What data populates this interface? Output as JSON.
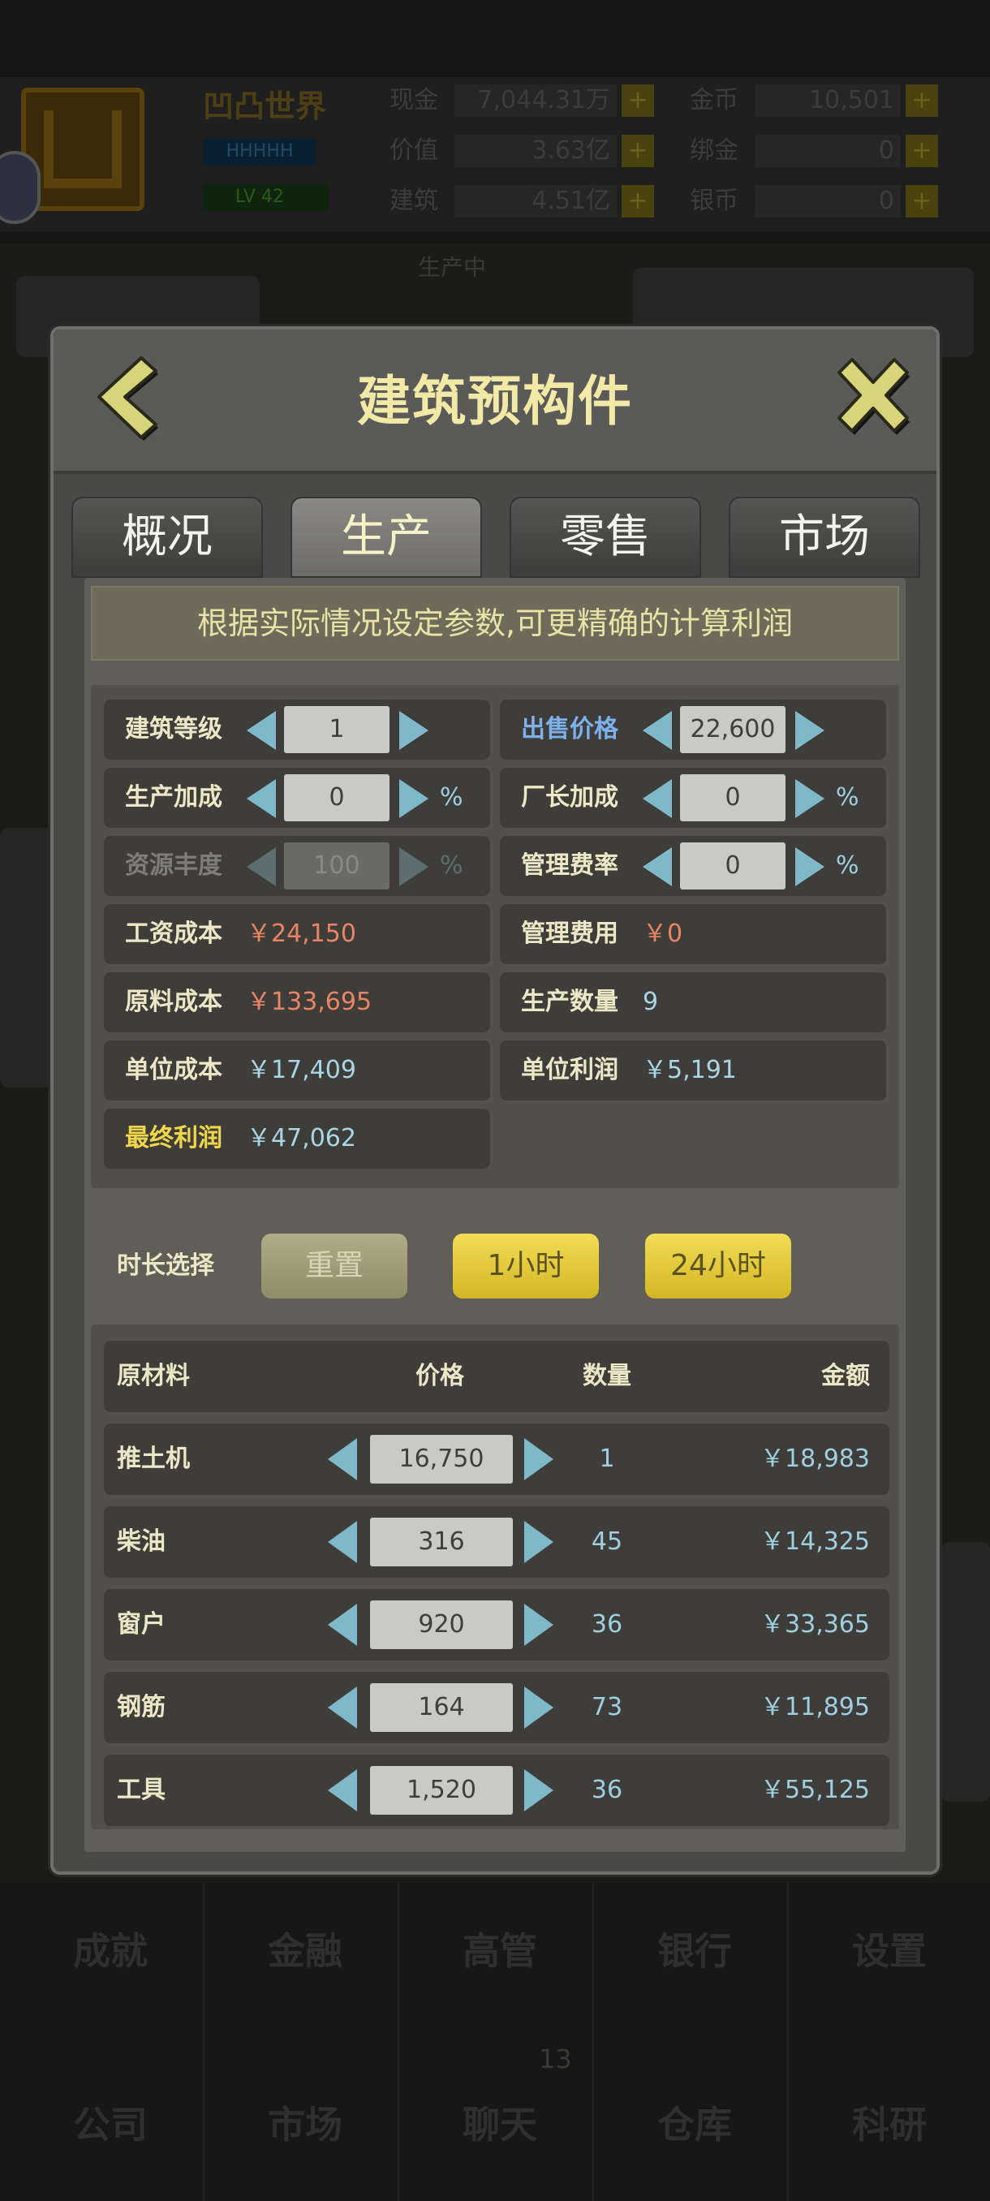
{
  "background": {
    "company_name": "凹凸世界",
    "badge_blue": "HHHHH",
    "badge_level": "LV 42",
    "stats": [
      {
        "label": "现金",
        "value": "7,044.31万"
      },
      {
        "label": "价值",
        "value": "3.63亿"
      },
      {
        "label": "建筑",
        "value": "4.51亿"
      },
      {
        "label": "金币",
        "value": "10,501"
      },
      {
        "label": "绑金",
        "value": "0"
      },
      {
        "label": "银币",
        "value": "0"
      }
    ],
    "hint": "生产中",
    "nav_row1": [
      "成就",
      "金融",
      "高管",
      "银行",
      "设置"
    ],
    "nav_row2": [
      "公司",
      "市场",
      "聊天",
      "仓库",
      "科研"
    ],
    "nav_badge": "13"
  },
  "dialog": {
    "title": "建筑预构件",
    "tabs": [
      {
        "label": "概况",
        "active": false
      },
      {
        "label": "生产",
        "active": true
      },
      {
        "label": "零售",
        "active": false
      },
      {
        "label": "市场",
        "active": false
      }
    ],
    "notice": "根据实际情况设定参数,可更精确的计算利润",
    "params": {
      "building_level": {
        "label": "建筑等级",
        "value": "1"
      },
      "sale_price": {
        "label": "出售价格",
        "value": "22,600"
      },
      "production_bonus": {
        "label": "生产加成",
        "value": "0",
        "unit": "%"
      },
      "manager_bonus": {
        "label": "厂长加成",
        "value": "0",
        "unit": "%"
      },
      "resource_abundance": {
        "label": "资源丰度",
        "value": "100",
        "unit": "%"
      },
      "management_rate": {
        "label": "管理费率",
        "value": "0",
        "unit": "%"
      },
      "wage_cost": {
        "label": "工资成本",
        "value": "￥24,150"
      },
      "management_fee": {
        "label": "管理费用",
        "value": "￥0"
      },
      "material_cost": {
        "label": "原料成本",
        "value": "￥133,695"
      },
      "production_qty": {
        "label": "生产数量",
        "value": "9"
      },
      "unit_cost": {
        "label": "单位成本",
        "value": "￥17,409"
      },
      "unit_profit": {
        "label": "单位利润",
        "value": "￥5,191"
      },
      "final_profit": {
        "label": "最终利润",
        "value": "￥47,062"
      }
    },
    "duration": {
      "label": "时长选择",
      "reset": "重置",
      "one_hour": "1小时",
      "day": "24小时"
    },
    "materials": {
      "headers": {
        "name": "原材料",
        "price": "价格",
        "qty": "数量",
        "amount": "金额"
      },
      "rows": [
        {
          "name": "推土机",
          "price": "16,750",
          "qty": "1",
          "amount": "￥18,983"
        },
        {
          "name": "柴油",
          "price": "316",
          "qty": "45",
          "amount": "￥14,325"
        },
        {
          "name": "窗户",
          "price": "920",
          "qty": "36",
          "amount": "￥33,365"
        },
        {
          "name": "钢筋",
          "price": "164",
          "qty": "73",
          "amount": "￥11,895"
        },
        {
          "name": "工具",
          "price": "1,520",
          "qty": "36",
          "amount": "￥55,125"
        }
      ]
    }
  }
}
